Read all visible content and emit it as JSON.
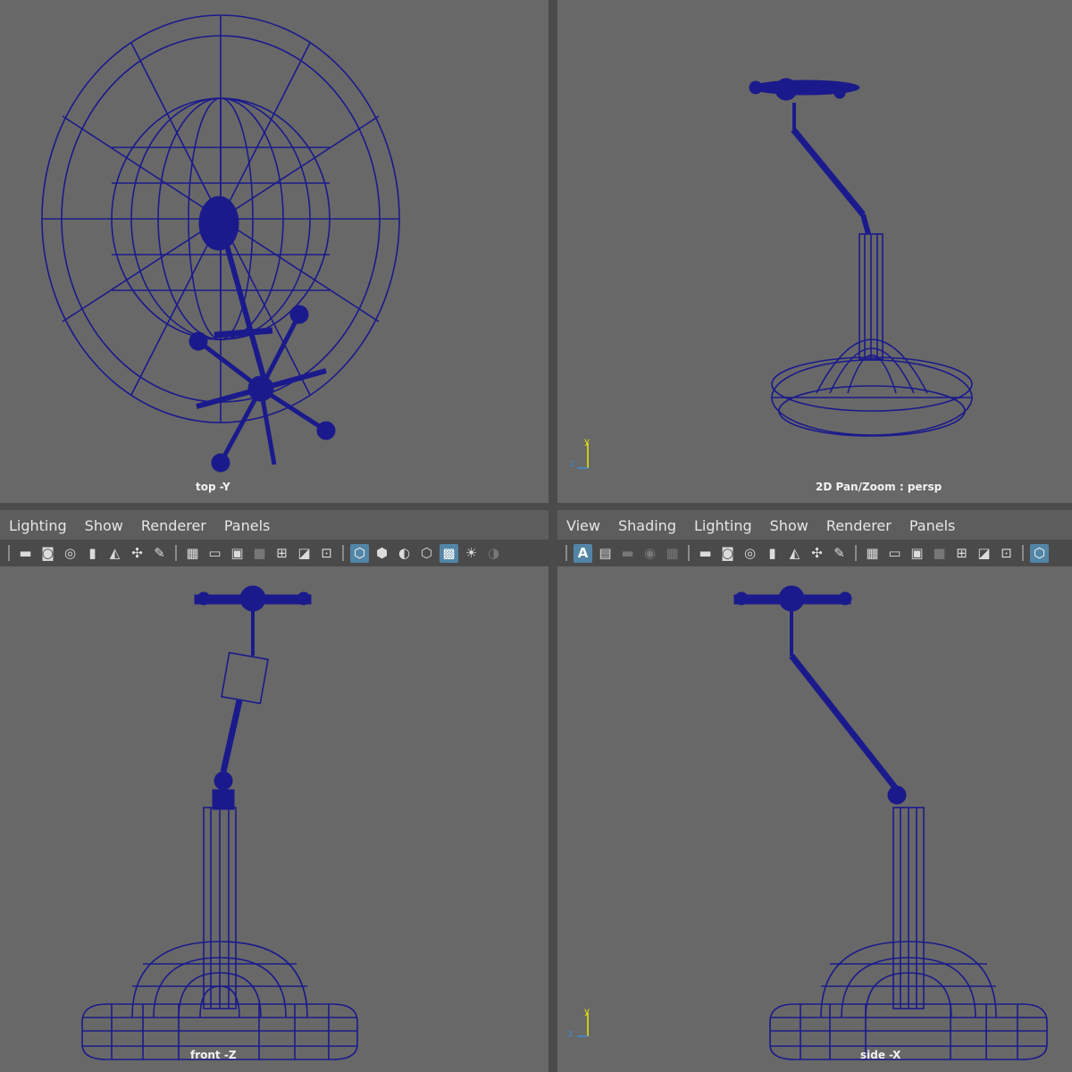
{
  "viewports": {
    "top": {
      "label": "top -Y"
    },
    "persp": {
      "label": "2D Pan/Zoom : persp"
    },
    "front": {
      "label": "front -Z"
    },
    "side": {
      "label": "side -X"
    }
  },
  "left_panel": {
    "menu": [
      "Lighting",
      "Show",
      "Renderer",
      "Panels"
    ]
  },
  "right_panel": {
    "menu": [
      "View",
      "Shading",
      "Lighting",
      "Show",
      "Renderer",
      "Panels"
    ]
  },
  "axis_gizmo": {
    "y": "y",
    "z": "z"
  },
  "toolbar_icons": [
    "camera-icon",
    "camera-attributes-icon",
    "camera-lock-icon",
    "bookmark-icon",
    "image-plane-icon",
    "gate-icon",
    "grease-pencil-icon",
    "grid-icon",
    "film-gate-icon",
    "resolution-gate-icon",
    "gate-mask-icon",
    "field-chart-icon",
    "safe-action-icon",
    "safe-title-icon",
    "wireframe-icon",
    "smooth-shade-icon",
    "default-material-icon",
    "wireframe-on-shaded-icon",
    "xray-icon",
    "lights-icon",
    "shadows-icon"
  ],
  "right_toolbar_letter": "A",
  "colors": {
    "wire": "#1b1a8c",
    "viewport_bg": "#686868",
    "active_icon": "#5285a6"
  }
}
